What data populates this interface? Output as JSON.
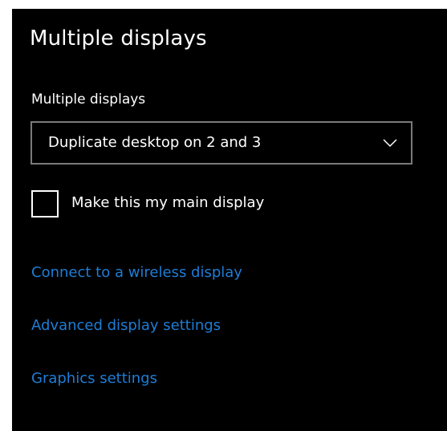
{
  "section": {
    "title": "Multiple displays"
  },
  "multiple_displays_setting": {
    "label": "Multiple displays",
    "selected_value": "Duplicate desktop on 2 and 3",
    "icon": "chevron-down-icon"
  },
  "main_display_checkbox": {
    "label": "Make this my main display",
    "checked": false
  },
  "links": {
    "wireless": "Connect to a wireless display",
    "advanced": "Advanced display settings",
    "graphics": "Graphics settings"
  },
  "colors": {
    "background": "#000000",
    "text": "#ffffff",
    "link": "#1e7dd6",
    "dropdown_border": "#7a7a7a"
  }
}
